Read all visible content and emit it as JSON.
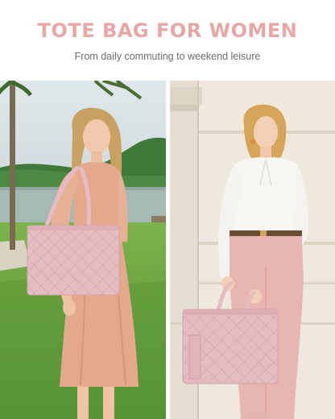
{
  "header": {
    "title": "TOTE BAG FOR WOMEN",
    "subtitle": "From daily commuting to weekend leisure"
  },
  "colors": {
    "title": "#e7a7a4",
    "subtitle": "#6b6b6b",
    "bag_pink": "#e8c1c6",
    "dress": "#e4a98d",
    "pants": "#e8b5b0",
    "grass": "#5d9a3a",
    "wall": "#efe9dd"
  },
  "icons": [
    "bag-quilted-pattern"
  ]
}
